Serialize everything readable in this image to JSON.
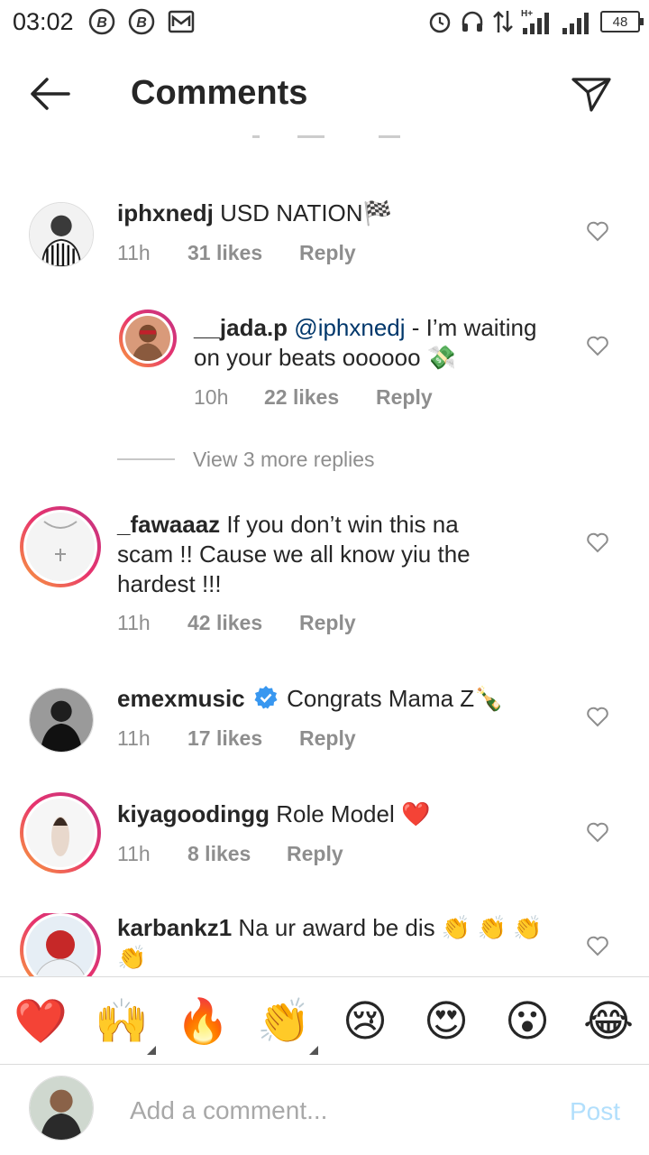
{
  "status_bar": {
    "time": "03:02",
    "battery": "48",
    "network": "H+"
  },
  "header": {
    "title": "Comments"
  },
  "comments": [
    {
      "username": "iphxnedj",
      "text": "USD NATION",
      "emoji": "🏁",
      "time": "11h",
      "likes": "31 likes",
      "reply": "Reply"
    },
    {
      "username": "__jada.p",
      "mention": "@iphxnedj",
      "text": "- I’m waiting on your beats oooooo",
      "emoji": "💸",
      "time": "10h",
      "likes": "22 likes",
      "reply": "Reply"
    },
    {
      "username": "_fawaaaz",
      "text": "If you don’t win this na scam !! Cause we all know yiu the hardest !!!",
      "time": "11h",
      "likes": "42 likes",
      "reply": "Reply"
    },
    {
      "username": "emexmusic",
      "text": "Congrats Mama Z",
      "emoji": "🍾",
      "time": "11h",
      "likes": "17 likes",
      "reply": "Reply"
    },
    {
      "username": "kiyagoodingg",
      "text": "Role Model",
      "emoji": "❤️",
      "time": "11h",
      "likes": "8 likes",
      "reply": "Reply"
    },
    {
      "username": "karbankz1",
      "text": "Na ur award be dis",
      "emoji": "👏 👏 👏 👏"
    }
  ],
  "view_more": "View 3 more replies",
  "emoji_bar": [
    "❤️",
    "🙌",
    "🔥",
    "👏",
    "😢",
    "😍",
    "😮",
    "😂"
  ],
  "composer": {
    "placeholder": "Add a comment...",
    "post_label": "Post"
  },
  "colors": {
    "primary_text": "#262626",
    "secondary_text": "#8e8e8e",
    "mention": "#00376b",
    "post_disabled": "#b2dffc",
    "verified": "#3897f0"
  }
}
